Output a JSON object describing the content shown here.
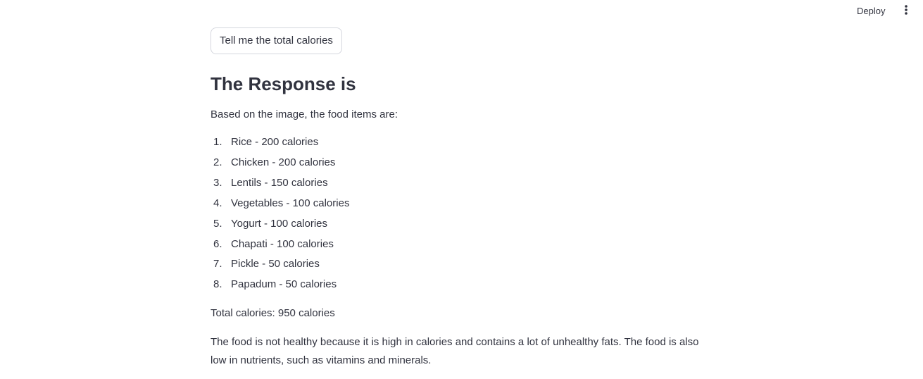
{
  "header": {
    "deploy_label": "Deploy",
    "menu_icon": "vertical-ellipsis-icon"
  },
  "main": {
    "button_label": "Tell me the total calories",
    "heading": "The Response is",
    "intro": "Based on the image, the food items are:",
    "items": [
      {
        "num": "1.",
        "text": "Rice - 200 calories"
      },
      {
        "num": "2.",
        "text": "Chicken - 200 calories"
      },
      {
        "num": "3.",
        "text": "Lentils - 150 calories"
      },
      {
        "num": "4.",
        "text": "Vegetables - 100 calories"
      },
      {
        "num": "5.",
        "text": "Yogurt - 100 calories"
      },
      {
        "num": "6.",
        "text": "Chapati - 100 calories"
      },
      {
        "num": "7.",
        "text": "Pickle - 50 calories"
      },
      {
        "num": "8.",
        "text": "Papadum - 50 calories"
      }
    ],
    "total": "Total calories: 950 calories",
    "conclusion": "The food is not healthy because it is high in calories and contains a lot of unhealthy fats. The food is also low in nutrients, such as vitamins and minerals."
  }
}
